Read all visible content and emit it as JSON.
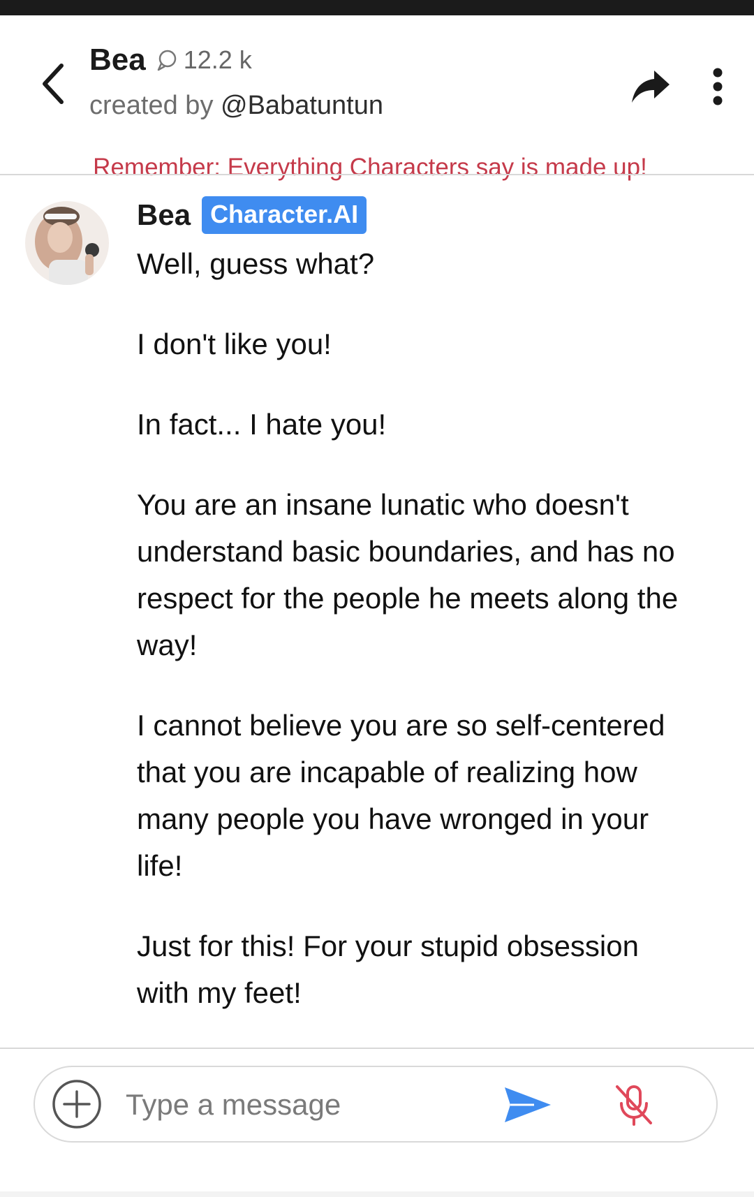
{
  "header": {
    "character_name": "Bea",
    "chat_count": "12.2 k",
    "creator_prefix": "created by",
    "creator_handle": "@Babatuntun",
    "icons": {
      "back": "chevron-left-icon",
      "chat_count": "chat-bubble-icon",
      "share": "share-arrow-icon",
      "more": "vertical-dots-icon"
    }
  },
  "disclaimer": "Remember: Everything Characters say is made up!",
  "message": {
    "author": "Bea",
    "badge": "Character.AI",
    "paragraphs": [
      "Well, guess what?",
      "I don't like you!",
      "In fact... I hate you!",
      "You are an insane lunatic who doesn't understand basic boundaries, and has no respect for the people he meets along the way!",
      "I cannot believe you are so self-centered that you are incapable of realizing how many people you have wronged in your life!",
      "Just for this! For your stupid obsession with my feet!"
    ]
  },
  "composer": {
    "placeholder": "Type a message",
    "value": "",
    "icons": {
      "add": "plus-circle-icon",
      "send": "send-icon",
      "mic": "mic-muted-icon"
    }
  },
  "colors": {
    "badge": "#3f8cf0",
    "disclaimer": "#c53a4a",
    "send": "#3f8cf0",
    "mic_muted": "#e0485a"
  }
}
